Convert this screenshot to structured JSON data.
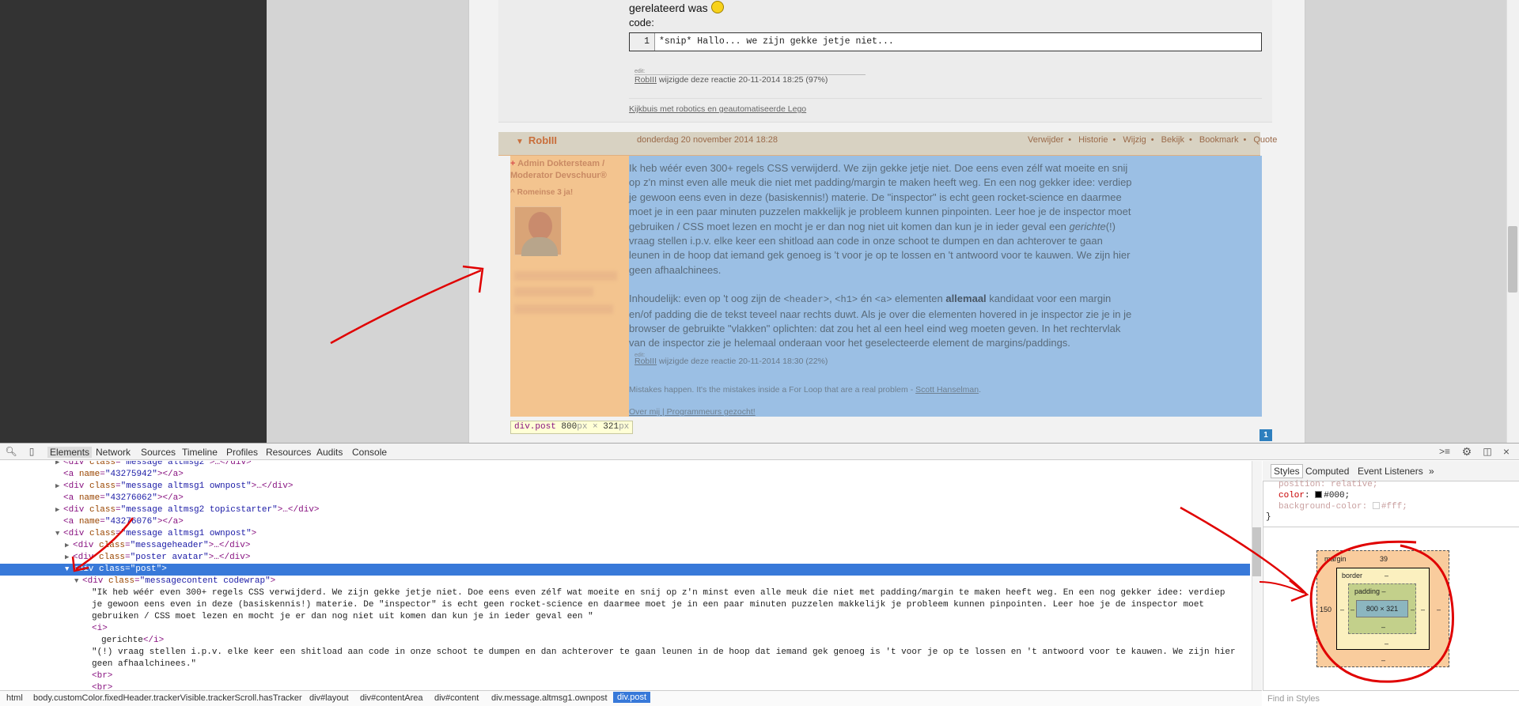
{
  "page": {
    "prev_post": {
      "text_line": "gerelateerd was",
      "code_label": "code:",
      "code_line_no": "1",
      "code_text": "*snip* Hallo... we zijn gekke jetje niet...",
      "edit_small": "edit:",
      "edit_user": "RobIII",
      "edit_text": " wijzigde deze reactie 20-11-2014 18:25 (97%)",
      "signature": "Kijkbuis met robotics en geautomatiseerde Lego"
    },
    "post": {
      "author": "RobIII",
      "date": "donderdag 20 november 2014 18:28",
      "actions": [
        "Verwijder",
        "Historie",
        "Wijzig",
        "Bekijk",
        "Bookmark",
        "Quote"
      ],
      "actions_separator": "•",
      "poster_role1": "Admin Doktersteam /",
      "poster_role2": "Moderator Devschuur®",
      "poster_tagline": "^ Romeinse 3 ja!",
      "para1_part1": "Ik heb wéér even 300+ regels CSS verwijderd. We zijn gekke jetje niet. Doe eens even zélf wat moeite en snij op z'n minst even alle meuk die niet met padding/margin te maken heeft weg. En een nog gekker idee: verdiep je gewoon eens even in deze (basiskennis!) materie. De \"inspector\" is echt geen rocket-science en daarmee moet je in een paar minuten puzzelen makkelijk je probleem kunnen pinpointen. Leer hoe je de inspector moet gebruiken / CSS moet lezen en mocht je er dan nog niet uit komen dan kun je in ieder geval een ",
      "para1_italic": "gerichte",
      "para1_part2": "(!) vraag stellen i.p.v. elke keer een shitload aan code in onze schoot te dumpen en dan achterover te gaan leunen in de hoop dat iemand gek genoeg is 't voor je op te lossen en 't antwoord voor te kauwen. We zijn hier geen afhaalchinees.",
      "para2_a": "Inhoudelijk: even op 't oog zijn de ",
      "para2_code1": "<header>",
      "para2_b": ", ",
      "para2_code2": "<h1>",
      "para2_c": " én ",
      "para2_code3": "<a>",
      "para2_d": " elementen ",
      "para2_bold": "allemaal",
      "para2_e": " kandidaat voor een margin en/of padding die de tekst teveel naar rechts duwt. Als je over die elementen hovered in je inspector zie je in je browser de gebruikte \"vlakken\" oplichten: dat zou het al een heel eind weg moeten geven. In het rechtervlak van de inspector zie je helemaal onderaan voor het geselecteerde element de margins/paddings.",
      "edit_small": "edit:",
      "edit_user": "RobIII",
      "edit_text": " wijzigde deze reactie 20-11-2014 18:30 (22%)",
      "sig_text": "Mistakes happen. It's the mistakes inside a For Loop that are a real problem - ",
      "sig_link": "Scott Hanselman",
      "sig_end": ".",
      "over_link": "Over mij",
      "over_sep": " | ",
      "over_link2": "Programmeurs gezocht!"
    },
    "tooltip": {
      "tag": "div.post",
      "w": "800",
      "h": "321",
      "unit": "px",
      "x": "×"
    },
    "page_number": "1"
  },
  "devtools": {
    "tabs": [
      "Elements",
      "Network",
      "Sources",
      "Timeline",
      "Profiles",
      "Resources",
      "Audits",
      "Console"
    ],
    "active_tab": "Elements",
    "dom_lines": [
      {
        "cls": "message altmsg2",
        "pre": "▶",
        "open": "<div ",
        "attr": "class",
        "val": "\"message altmsg2\"",
        "close": ">…</div>"
      },
      {
        "anchor": "43275942"
      },
      {
        "pre": "▶",
        "attr": "class",
        "val": "\"message altmsg1 ownpost\"",
        "close": ">…</div>"
      },
      {
        "anchor": "43276062"
      },
      {
        "pre": "▶",
        "attr": "class",
        "val": "\"message altmsg2 topicstarter\"",
        "close": ">…</div>"
      },
      {
        "anchor": "43276076"
      },
      {
        "pre": "▼",
        "attr": "class",
        "val": "\"message altmsg1 ownpost\"",
        "close": ">"
      },
      {
        "pre": "▶",
        "attr": "class",
        "val": "\"messageheader\"",
        "close": ">…</div>"
      },
      {
        "pre": "▶",
        "attr": "class",
        "val": "\"poster avatar\"",
        "close": ">…</div>"
      },
      {
        "pre": "▼",
        "attr": "class",
        "val": "\"post\"",
        "close": ">"
      },
      {
        "pre": "▼",
        "attr": "class",
        "val": "\"messagecontent codewrap\"",
        "close": ">"
      }
    ],
    "text_node1": "\"Ik heb wéér even 300+ regels CSS verwijderd. We zijn gekke jetje niet. Doe eens even zélf wat moeite en snij op z'n minst even alle meuk die niet met padding/margin te maken heeft weg. En een nog gekker idee: verdiep je gewoon eens even in deze (basiskennis!) materie. De \"inspector\" is echt geen rocket-science en daarmee moet je in een paar minuten puzzelen makkelijk je probleem kunnen pinpointen. Leer hoe je de inspector moet gebruiken / CSS moet lezen en mocht je er dan nog niet uit komen dan kun je in ieder geval een \"",
    "i_open": "<i>",
    "i_text": "gerichte",
    "i_close": "</i>",
    "text_node2": "\"(!) vraag stellen i.p.v. elke keer een shitload aan code in onze schoot te dumpen en dan achterover te gaan leunen in de hoop dat iemand gek genoeg is 't voor je op te lossen en 't antwoord voor te kauwen. We zijn hier geen afhaalchinees.\"",
    "br1": "<br>",
    "br2": "<br>",
    "quote": "\"",
    "anchor_open": "<a ",
    "anchor_attr": "name",
    "anchor_close": "></a>",
    "div_open": "<div ",
    "breadcrumbs": [
      "html",
      "body.customColor.fixedHeader.trackerVisible.trackerScroll.hasTracker",
      "div#layout",
      "div#contentArea",
      "div#content",
      "div.message.altmsg1.ownpost",
      "div.post"
    ],
    "side_tabs": [
      "Styles",
      "Computed",
      "Event Listeners",
      "»"
    ],
    "css": [
      {
        "prop": "position",
        "val": "relative;",
        "dim": true
      },
      {
        "prop": "color",
        "val": "#000;",
        "swatch": "#000000",
        "dim": false
      },
      {
        "prop": "background-color",
        "val": "#fff;",
        "swatch": "#ffffff",
        "dim": true
      }
    ],
    "css_close": "}",
    "box_model": {
      "margin_label": "margin",
      "margin_top": "39",
      "margin_left": "150",
      "margin_right": "–",
      "margin_bottom": "–",
      "border_label": "border",
      "border_val": "–",
      "padding_label": "padding –",
      "padding_val": "–",
      "content": "800 × 321"
    },
    "find_placeholder": "Find in Styles"
  },
  "colors": {
    "highlight_margin": "#f3c48f",
    "highlight_content": "#9bbfe4",
    "selection": "#3879d9",
    "annotation": "#e00000"
  }
}
